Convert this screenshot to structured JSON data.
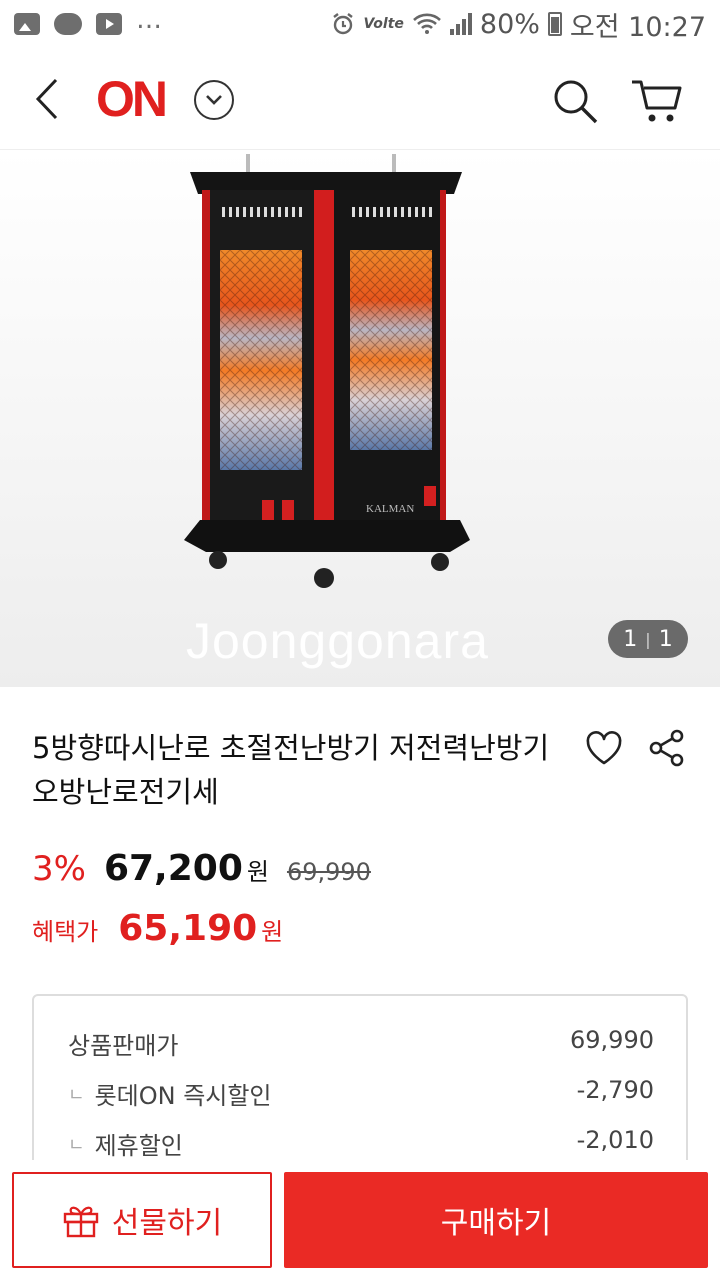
{
  "status_bar": {
    "network": "Volte",
    "battery": "80%",
    "time": "오전 10:27"
  },
  "header": {
    "logo": "ON",
    "icons": [
      "back-icon",
      "dropdown-chevron-icon",
      "search-icon",
      "cart-icon"
    ]
  },
  "gallery": {
    "watermark": "Joonggonara",
    "current": "1",
    "total": "1",
    "image_brand": "KALMAN"
  },
  "product": {
    "title": "5방향따시난로 초절전난방기 저전력난방기 오방난로전기세",
    "discount_rate": "3%",
    "price": "67,200",
    "currency": "원",
    "original_price": "69,990",
    "benefit_label": "혜택가",
    "benefit_price": "65,190"
  },
  "breakdown": {
    "rows": [
      {
        "label": "상품판매가",
        "value": "69,990"
      },
      {
        "label": "롯데ON 즉시할인",
        "value": "-2,790"
      },
      {
        "label": "제휴할인",
        "value": "-2,010"
      }
    ]
  },
  "actions": {
    "gift_label": "선물하기",
    "buy_label": "구매하기"
  },
  "colors": {
    "brand_red": "#e0201f",
    "buy_red": "#ea2a25"
  }
}
